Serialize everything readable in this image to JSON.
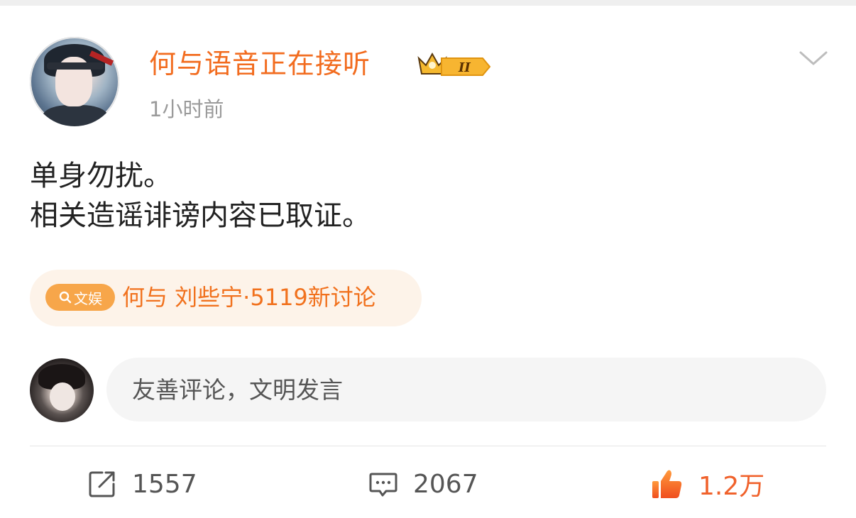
{
  "post": {
    "username": "何与语音正在接听",
    "badge_icon": "vip-crown-level-2-icon",
    "timestamp": "1小时前",
    "content_lines": [
      "单身勿扰。",
      "相关造谣诽谤内容已取证。"
    ],
    "topic": {
      "tag_label": "文娱",
      "text": "何与 刘些宁·5119新讨论"
    },
    "comment_box": {
      "placeholder": "友善评论，文明发言"
    },
    "actions": {
      "repost_count": "1557",
      "comment_count": "2067",
      "like_count": "1.2万"
    }
  },
  "colors": {
    "username": "#f26c1f",
    "topic_bg": "#fdf3e9",
    "topic_tag_bg": "#f7a64a",
    "like": "#f0622c"
  }
}
